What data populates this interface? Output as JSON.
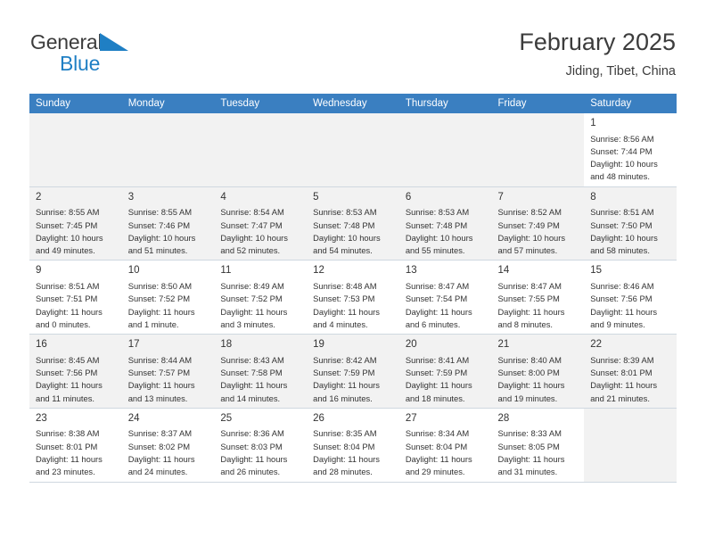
{
  "brand": {
    "name_top": "General",
    "name_bottom": "Blue",
    "flag_icon": "triangle-flag-icon"
  },
  "header": {
    "month_title": "February 2025",
    "location": "Jiding, Tibet, China"
  },
  "colors": {
    "header_row_bg": "#3a7fc1",
    "brand_blue": "#1f7fc4",
    "row_shade": "#f2f2f2",
    "cell_border": "#cfd8e0",
    "text": "#333333"
  },
  "weekdays": [
    "Sunday",
    "Monday",
    "Tuesday",
    "Wednesday",
    "Thursday",
    "Friday",
    "Saturday"
  ],
  "weeks": [
    {
      "shaded": false,
      "days": [
        {
          "day": "",
          "sunrise": "",
          "sunset": "",
          "daylight": "",
          "empty": true
        },
        {
          "day": "",
          "sunrise": "",
          "sunset": "",
          "daylight": "",
          "empty": true
        },
        {
          "day": "",
          "sunrise": "",
          "sunset": "",
          "daylight": "",
          "empty": true
        },
        {
          "day": "",
          "sunrise": "",
          "sunset": "",
          "daylight": "",
          "empty": true
        },
        {
          "day": "",
          "sunrise": "",
          "sunset": "",
          "daylight": "",
          "empty": true
        },
        {
          "day": "",
          "sunrise": "",
          "sunset": "",
          "daylight": "",
          "empty": true
        },
        {
          "day": "1",
          "sunrise": "Sunrise: 8:56 AM",
          "sunset": "Sunset: 7:44 PM",
          "daylight": "Daylight: 10 hours and 48 minutes.",
          "empty": false
        }
      ]
    },
    {
      "shaded": true,
      "days": [
        {
          "day": "2",
          "sunrise": "Sunrise: 8:55 AM",
          "sunset": "Sunset: 7:45 PM",
          "daylight": "Daylight: 10 hours and 49 minutes.",
          "empty": false
        },
        {
          "day": "3",
          "sunrise": "Sunrise: 8:55 AM",
          "sunset": "Sunset: 7:46 PM",
          "daylight": "Daylight: 10 hours and 51 minutes.",
          "empty": false
        },
        {
          "day": "4",
          "sunrise": "Sunrise: 8:54 AM",
          "sunset": "Sunset: 7:47 PM",
          "daylight": "Daylight: 10 hours and 52 minutes.",
          "empty": false
        },
        {
          "day": "5",
          "sunrise": "Sunrise: 8:53 AM",
          "sunset": "Sunset: 7:48 PM",
          "daylight": "Daylight: 10 hours and 54 minutes.",
          "empty": false
        },
        {
          "day": "6",
          "sunrise": "Sunrise: 8:53 AM",
          "sunset": "Sunset: 7:48 PM",
          "daylight": "Daylight: 10 hours and 55 minutes.",
          "empty": false
        },
        {
          "day": "7",
          "sunrise": "Sunrise: 8:52 AM",
          "sunset": "Sunset: 7:49 PM",
          "daylight": "Daylight: 10 hours and 57 minutes.",
          "empty": false
        },
        {
          "day": "8",
          "sunrise": "Sunrise: 8:51 AM",
          "sunset": "Sunset: 7:50 PM",
          "daylight": "Daylight: 10 hours and 58 minutes.",
          "empty": false
        }
      ]
    },
    {
      "shaded": false,
      "days": [
        {
          "day": "9",
          "sunrise": "Sunrise: 8:51 AM",
          "sunset": "Sunset: 7:51 PM",
          "daylight": "Daylight: 11 hours and 0 minutes.",
          "empty": false
        },
        {
          "day": "10",
          "sunrise": "Sunrise: 8:50 AM",
          "sunset": "Sunset: 7:52 PM",
          "daylight": "Daylight: 11 hours and 1 minute.",
          "empty": false
        },
        {
          "day": "11",
          "sunrise": "Sunrise: 8:49 AM",
          "sunset": "Sunset: 7:52 PM",
          "daylight": "Daylight: 11 hours and 3 minutes.",
          "empty": false
        },
        {
          "day": "12",
          "sunrise": "Sunrise: 8:48 AM",
          "sunset": "Sunset: 7:53 PM",
          "daylight": "Daylight: 11 hours and 4 minutes.",
          "empty": false
        },
        {
          "day": "13",
          "sunrise": "Sunrise: 8:47 AM",
          "sunset": "Sunset: 7:54 PM",
          "daylight": "Daylight: 11 hours and 6 minutes.",
          "empty": false
        },
        {
          "day": "14",
          "sunrise": "Sunrise: 8:47 AM",
          "sunset": "Sunset: 7:55 PM",
          "daylight": "Daylight: 11 hours and 8 minutes.",
          "empty": false
        },
        {
          "day": "15",
          "sunrise": "Sunrise: 8:46 AM",
          "sunset": "Sunset: 7:56 PM",
          "daylight": "Daylight: 11 hours and 9 minutes.",
          "empty": false
        }
      ]
    },
    {
      "shaded": true,
      "days": [
        {
          "day": "16",
          "sunrise": "Sunrise: 8:45 AM",
          "sunset": "Sunset: 7:56 PM",
          "daylight": "Daylight: 11 hours and 11 minutes.",
          "empty": false
        },
        {
          "day": "17",
          "sunrise": "Sunrise: 8:44 AM",
          "sunset": "Sunset: 7:57 PM",
          "daylight": "Daylight: 11 hours and 13 minutes.",
          "empty": false
        },
        {
          "day": "18",
          "sunrise": "Sunrise: 8:43 AM",
          "sunset": "Sunset: 7:58 PM",
          "daylight": "Daylight: 11 hours and 14 minutes.",
          "empty": false
        },
        {
          "day": "19",
          "sunrise": "Sunrise: 8:42 AM",
          "sunset": "Sunset: 7:59 PM",
          "daylight": "Daylight: 11 hours and 16 minutes.",
          "empty": false
        },
        {
          "day": "20",
          "sunrise": "Sunrise: 8:41 AM",
          "sunset": "Sunset: 7:59 PM",
          "daylight": "Daylight: 11 hours and 18 minutes.",
          "empty": false
        },
        {
          "day": "21",
          "sunrise": "Sunrise: 8:40 AM",
          "sunset": "Sunset: 8:00 PM",
          "daylight": "Daylight: 11 hours and 19 minutes.",
          "empty": false
        },
        {
          "day": "22",
          "sunrise": "Sunrise: 8:39 AM",
          "sunset": "Sunset: 8:01 PM",
          "daylight": "Daylight: 11 hours and 21 minutes.",
          "empty": false
        }
      ]
    },
    {
      "shaded": false,
      "days": [
        {
          "day": "23",
          "sunrise": "Sunrise: 8:38 AM",
          "sunset": "Sunset: 8:01 PM",
          "daylight": "Daylight: 11 hours and 23 minutes.",
          "empty": false
        },
        {
          "day": "24",
          "sunrise": "Sunrise: 8:37 AM",
          "sunset": "Sunset: 8:02 PM",
          "daylight": "Daylight: 11 hours and 24 minutes.",
          "empty": false
        },
        {
          "day": "25",
          "sunrise": "Sunrise: 8:36 AM",
          "sunset": "Sunset: 8:03 PM",
          "daylight": "Daylight: 11 hours and 26 minutes.",
          "empty": false
        },
        {
          "day": "26",
          "sunrise": "Sunrise: 8:35 AM",
          "sunset": "Sunset: 8:04 PM",
          "daylight": "Daylight: 11 hours and 28 minutes.",
          "empty": false
        },
        {
          "day": "27",
          "sunrise": "Sunrise: 8:34 AM",
          "sunset": "Sunset: 8:04 PM",
          "daylight": "Daylight: 11 hours and 29 minutes.",
          "empty": false
        },
        {
          "day": "28",
          "sunrise": "Sunrise: 8:33 AM",
          "sunset": "Sunset: 8:05 PM",
          "daylight": "Daylight: 11 hours and 31 minutes.",
          "empty": false
        },
        {
          "day": "",
          "sunrise": "",
          "sunset": "",
          "daylight": "",
          "empty": true
        }
      ]
    }
  ]
}
